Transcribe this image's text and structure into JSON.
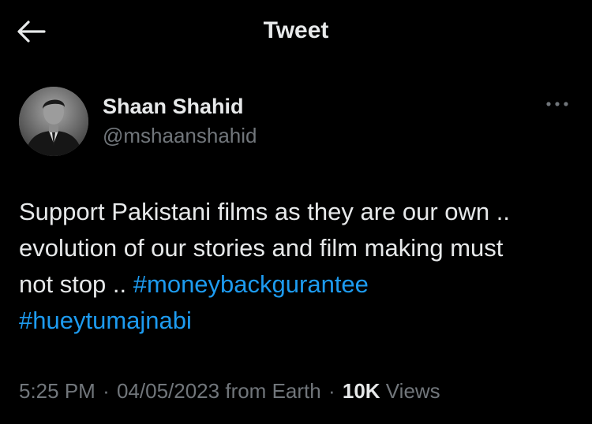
{
  "header": {
    "title": "Tweet",
    "back_icon": "arrow-left-icon"
  },
  "author": {
    "display_name": "Shaan Shahid",
    "handle": "@mshaanshahid",
    "avatar_icon": "profile-photo"
  },
  "more_icon": "more-horizontal-icon",
  "tweet": {
    "text_lines": [
      "Support Pakistani films as they are our own ..",
      "evolution of our stories and film making must",
      "not stop .. "
    ],
    "hashtags": [
      "#moneybackgurantee",
      "#hueytumajnabi"
    ]
  },
  "meta": {
    "time": "5:25 PM",
    "separator": "·",
    "date": "04/05/2023",
    "source": "from Earth",
    "views_count": "10K",
    "views_label": "Views"
  },
  "colors": {
    "background": "#000000",
    "text": "#e7e9ea",
    "secondary": "#71767b",
    "link": "#1d9bf0"
  }
}
